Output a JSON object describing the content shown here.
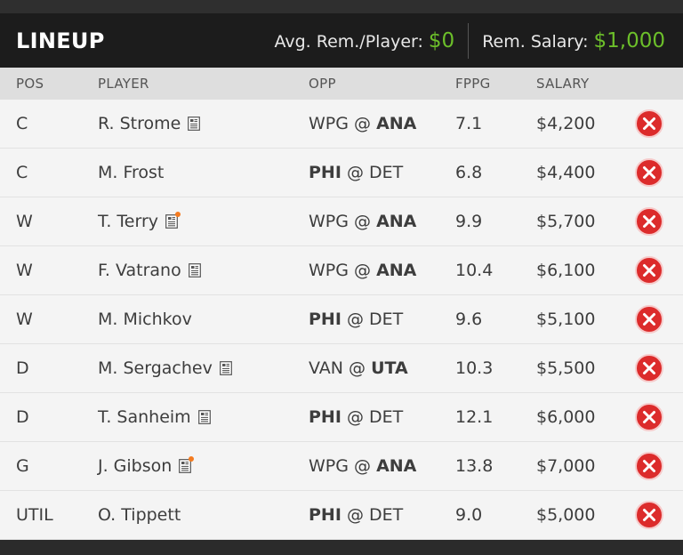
{
  "header": {
    "title": "LINEUP",
    "avg_label": "Avg. Rem./Player:",
    "avg_value": "$0",
    "rem_label": "Rem. Salary:",
    "rem_value": "$1,000"
  },
  "columns": {
    "pos": "POS",
    "player": "PLAYER",
    "opp": "OPP",
    "fppg": "FPPG",
    "salary": "SALARY"
  },
  "colors": {
    "accent_green": "#6cbf2a",
    "remove_red": "#dc2b2b",
    "news_alert": "#f47b20"
  },
  "rows": [
    {
      "pos": "C",
      "player": "R. Strome",
      "news": true,
      "news_alert": false,
      "away": "WPG",
      "sep": "@",
      "home": "ANA",
      "bold_side": "home",
      "fppg": "7.1",
      "salary": "$4,200"
    },
    {
      "pos": "C",
      "player": "M. Frost",
      "news": false,
      "news_alert": false,
      "away": "PHI",
      "sep": "@",
      "home": "DET",
      "bold_side": "away",
      "fppg": "6.8",
      "salary": "$4,400"
    },
    {
      "pos": "W",
      "player": "T. Terry",
      "news": true,
      "news_alert": true,
      "away": "WPG",
      "sep": "@",
      "home": "ANA",
      "bold_side": "home",
      "fppg": "9.9",
      "salary": "$5,700"
    },
    {
      "pos": "W",
      "player": "F. Vatrano",
      "news": true,
      "news_alert": false,
      "away": "WPG",
      "sep": "@",
      "home": "ANA",
      "bold_side": "home",
      "fppg": "10.4",
      "salary": "$6,100"
    },
    {
      "pos": "W",
      "player": "M. Michkov",
      "news": false,
      "news_alert": false,
      "away": "PHI",
      "sep": "@",
      "home": "DET",
      "bold_side": "away",
      "fppg": "9.6",
      "salary": "$5,100"
    },
    {
      "pos": "D",
      "player": "M. Sergachev",
      "news": true,
      "news_alert": false,
      "away": "VAN",
      "sep": "@",
      "home": "UTA",
      "bold_side": "home",
      "fppg": "10.3",
      "salary": "$5,500"
    },
    {
      "pos": "D",
      "player": "T. Sanheim",
      "news": true,
      "news_alert": false,
      "away": "PHI",
      "sep": "@",
      "home": "DET",
      "bold_side": "away",
      "fppg": "12.1",
      "salary": "$6,000"
    },
    {
      "pos": "G",
      "player": "J. Gibson",
      "news": true,
      "news_alert": true,
      "away": "WPG",
      "sep": "@",
      "home": "ANA",
      "bold_side": "home",
      "fppg": "13.8",
      "salary": "$7,000"
    },
    {
      "pos": "UTIL",
      "player": "O. Tippett",
      "news": false,
      "news_alert": false,
      "away": "PHI",
      "sep": "@",
      "home": "DET",
      "bold_side": "away",
      "fppg": "9.0",
      "salary": "$5,000"
    }
  ]
}
